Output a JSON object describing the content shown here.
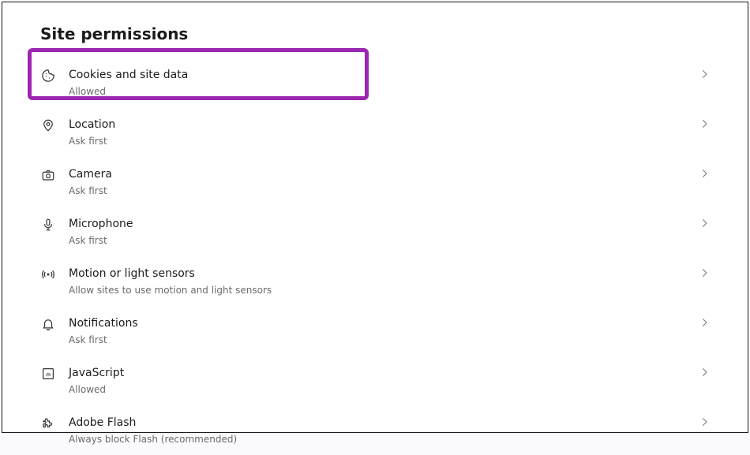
{
  "title": "Site permissions",
  "items": [
    {
      "key": "cookies",
      "label": "Cookies and site data",
      "sub": "Allowed"
    },
    {
      "key": "location",
      "label": "Location",
      "sub": "Ask first"
    },
    {
      "key": "camera",
      "label": "Camera",
      "sub": "Ask first"
    },
    {
      "key": "microphone",
      "label": "Microphone",
      "sub": "Ask first"
    },
    {
      "key": "motion",
      "label": "Motion or light sensors",
      "sub": "Allow sites to use motion and light sensors"
    },
    {
      "key": "notifications",
      "label": "Notifications",
      "sub": "Ask first"
    },
    {
      "key": "javascript",
      "label": "JavaScript",
      "sub": "Allowed"
    },
    {
      "key": "flash",
      "label": "Adobe Flash",
      "sub": "Always block Flash (recommended)"
    }
  ],
  "highlighted_item": "cookies"
}
